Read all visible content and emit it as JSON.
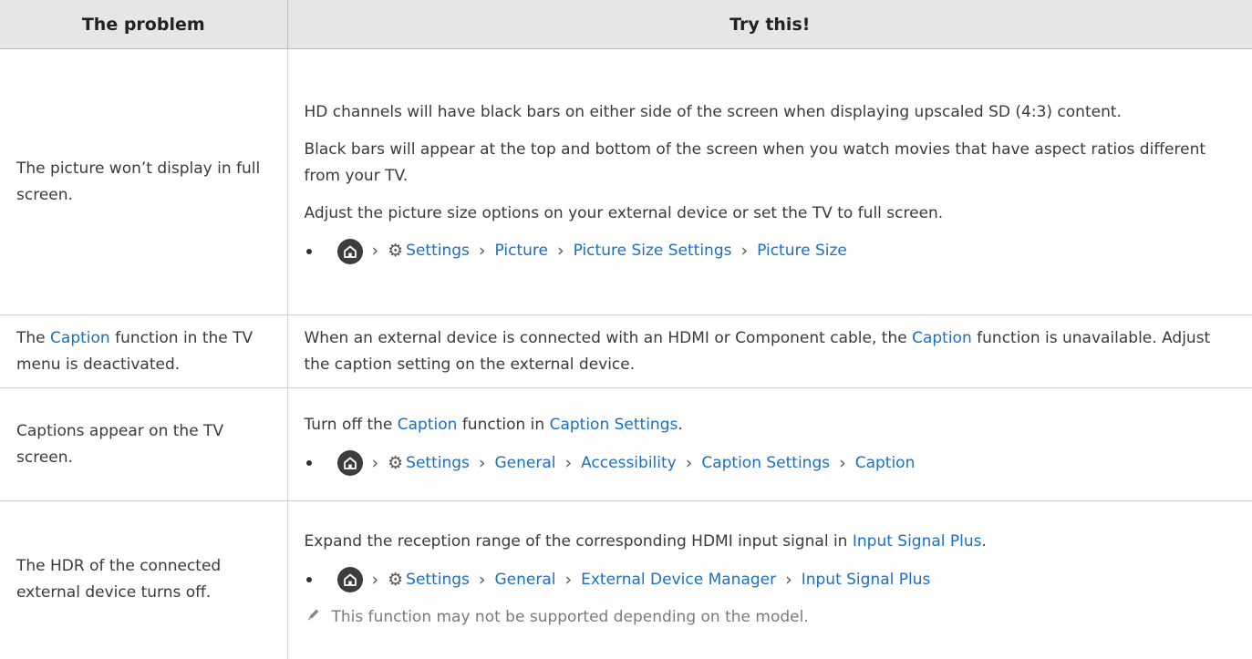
{
  "header": {
    "col1": "The problem",
    "col2": "Try this!"
  },
  "rows": [
    {
      "problem": "The picture won’t display in full screen.",
      "paragraphs": [
        "HD channels will have black bars on either side of the screen when displaying upscaled SD (4:3) content.",
        "Black bars will appear at the top and bottom of the screen when you watch movies that have aspect ratios different from your TV.",
        "Adjust the picture size options on your external device or set the TV to full screen."
      ],
      "path": [
        "Settings",
        "Picture",
        "Picture Size Settings",
        "Picture Size"
      ]
    },
    {
      "problem_pre": "The ",
      "problem_hl": "Caption",
      "problem_post": " function in the TV menu is deactivated.",
      "fix_pre": "When an external device is connected with an HDMI or Component cable, the ",
      "fix_hl": "Caption",
      "fix_post": " function is unavailable. Adjust the caption setting on the external device."
    },
    {
      "problem": "Captions appear on the TV screen.",
      "fix_pre": "Turn off the ",
      "fix_hl1": "Caption",
      "fix_mid": " function in ",
      "fix_hl2": "Caption Settings",
      "fix_post": ".",
      "path": [
        "Settings",
        "General",
        "Accessibility",
        "Caption Settings",
        "Caption"
      ]
    },
    {
      "problem": "The HDR of the connected external device turns off.",
      "fix_pre": "Expand the reception range of the corresponding HDMI input signal in ",
      "fix_hl": "Input Signal Plus",
      "fix_post": ".",
      "path": [
        "Settings",
        "General",
        "External Device Manager",
        "Input Signal Plus"
      ],
      "note": "This function may not be supported depending on the model."
    }
  ],
  "icons": {
    "home": "home-icon",
    "settings": "gear-icon",
    "separator": "chevron-right-icon",
    "note": "pencil-note-icon"
  },
  "colors": {
    "link": "#1a6fc5",
    "header_bg": "#e6e6e6"
  }
}
